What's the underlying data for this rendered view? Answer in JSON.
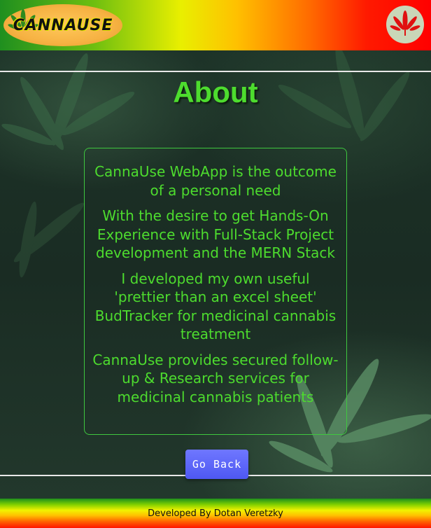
{
  "header": {
    "logo_text": "CANNAUSE",
    "leaf_icon": "cannabis-leaf-icon"
  },
  "main": {
    "title": "About",
    "paragraphs": [
      "CannaUse WebApp is the outcome of a personal need",
      "With the desire to get Hands-On Experience with Full-Stack Project development and the MERN Stack",
      "I developed my own useful 'prettier than an excel sheet' BudTracker for medicinal cannabis treatment",
      "CannaUse provides secured follow-up & Research services for medicinal cannabis patients"
    ],
    "go_back_label": "Go Back"
  },
  "footer": {
    "credit": "Developed By Dotan Veretzky"
  },
  "colors": {
    "accent_green": "#4ddc2e",
    "button_blue": "#5a63f6",
    "background": "#1b2e24"
  }
}
